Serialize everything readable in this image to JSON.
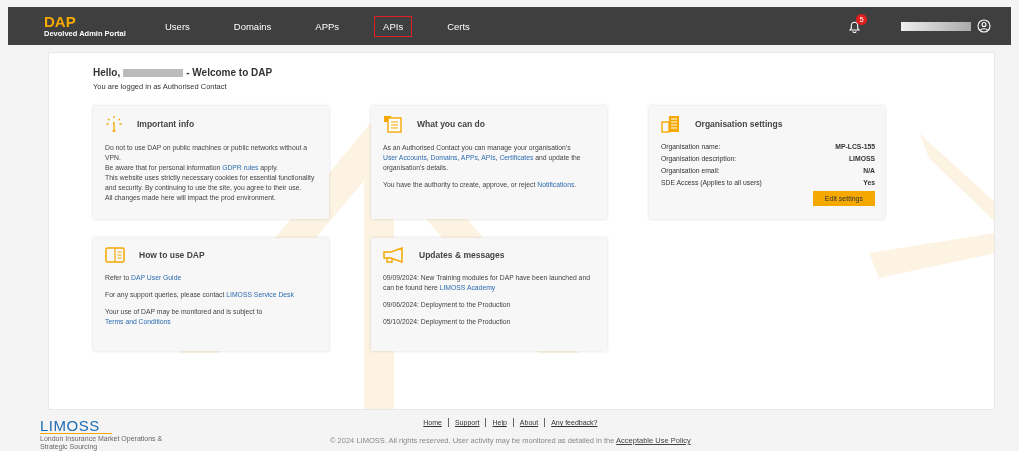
{
  "header": {
    "logo": "DAP",
    "logo_subtitle": "Devolved Admin Portal",
    "nav": [
      {
        "label": "Users",
        "selected": false
      },
      {
        "label": "Domains",
        "selected": false
      },
      {
        "label": "APPs",
        "selected": false
      },
      {
        "label": "APIs",
        "selected": true
      },
      {
        "label": "Certs",
        "selected": false
      }
    ],
    "notification_count": "5"
  },
  "greeting": {
    "hello": "Hello,",
    "welcome": "- Welcome to DAP",
    "subtitle": "You are logged in as Authorised Contact"
  },
  "cards": [
    {
      "title": "Important info",
      "kind": "tight",
      "paragraphs": [
        [
          {
            "kind": "text",
            "text": "Do not to use DAP on public machines or public networks without a VPN."
          }
        ],
        [
          {
            "kind": "text",
            "text": "Be aware that for personal information "
          },
          {
            "kind": "link",
            "text": "GDPR rules"
          },
          {
            "kind": "text",
            "text": " apply."
          }
        ],
        [
          {
            "kind": "text",
            "text": "This website uses strictly necessary cookies for essential functionality and security. By continuing to use the site, you agree to their use."
          }
        ],
        [
          {
            "kind": "text",
            "text": "All changes made here will impact the prod environment."
          }
        ]
      ]
    },
    {
      "title": "What you can do",
      "kind": "spaced",
      "paragraphs": [
        [
          {
            "kind": "text",
            "text": "As an Authorised Contact you can manage your organisation's "
          },
          {
            "kind": "link",
            "text": "User Accounts"
          },
          {
            "kind": "text",
            "text": ", "
          },
          {
            "kind": "link",
            "text": "Domains"
          },
          {
            "kind": "text",
            "text": ", "
          },
          {
            "kind": "link",
            "text": "APPs"
          },
          {
            "kind": "text",
            "text": ", "
          },
          {
            "kind": "link",
            "text": "APIs"
          },
          {
            "kind": "text",
            "text": ", "
          },
          {
            "kind": "link",
            "text": "Certificates"
          },
          {
            "kind": "text",
            "text": " and update the organisation's details."
          }
        ],
        [
          {
            "kind": "text",
            "text": "You have the authority to create, approve, or reject "
          },
          {
            "kind": "link",
            "text": "Notifications"
          },
          {
            "kind": "text",
            "text": "."
          }
        ]
      ]
    },
    {
      "title": "Organisation settings",
      "kind": "settings",
      "rows": [
        {
          "label": "Organisation name:",
          "value": "MP-LCS-155"
        },
        {
          "label": "Organisation description:",
          "value": "LIMOSS"
        },
        {
          "label": "Organisation email:",
          "value": "N/A"
        },
        {
          "label": "SDE Access (Applies to all users)",
          "value": "Yes"
        }
      ],
      "button": "Edit settings"
    },
    {
      "title": "How to use DAP",
      "kind": "spaced",
      "paragraphs": [
        [
          {
            "kind": "text",
            "text": "Refer to "
          },
          {
            "kind": "link",
            "text": "DAP User Guide"
          }
        ],
        [
          {
            "kind": "text",
            "text": "For any support queries, please contact "
          },
          {
            "kind": "link",
            "text": "LIMOSS Service Desk"
          }
        ],
        [
          {
            "kind": "text",
            "text": "Your use of DAP may be monitored and is subject to "
          },
          {
            "kind": "link",
            "text": "Terms and Conditions"
          }
        ]
      ]
    },
    {
      "title": "Updates & messages",
      "kind": "spaced",
      "paragraphs": [
        [
          {
            "kind": "text",
            "text": "09/09/2024: New Training modules for DAP have been launched and can be found here "
          },
          {
            "kind": "link",
            "text": "LIMOSS Academy"
          }
        ],
        [
          {
            "kind": "text",
            "text": "09/06/2024: Deployment to the Production"
          }
        ],
        [
          {
            "kind": "text",
            "text": "05/10/2024: Deployment to the Production"
          }
        ]
      ]
    }
  ],
  "footer": {
    "logo": "LIMOSS",
    "logo_tagline": "London Insurance Market Operations & Strategic Sourcing",
    "links": [
      "Home",
      "Support",
      "Help",
      "About",
      "Any feedback?"
    ],
    "copyright": "© 2024 LIMOSS. All rights reserved. User activity may be monitored as detailed in the",
    "policy_link": "Acceptable Use Policy"
  }
}
